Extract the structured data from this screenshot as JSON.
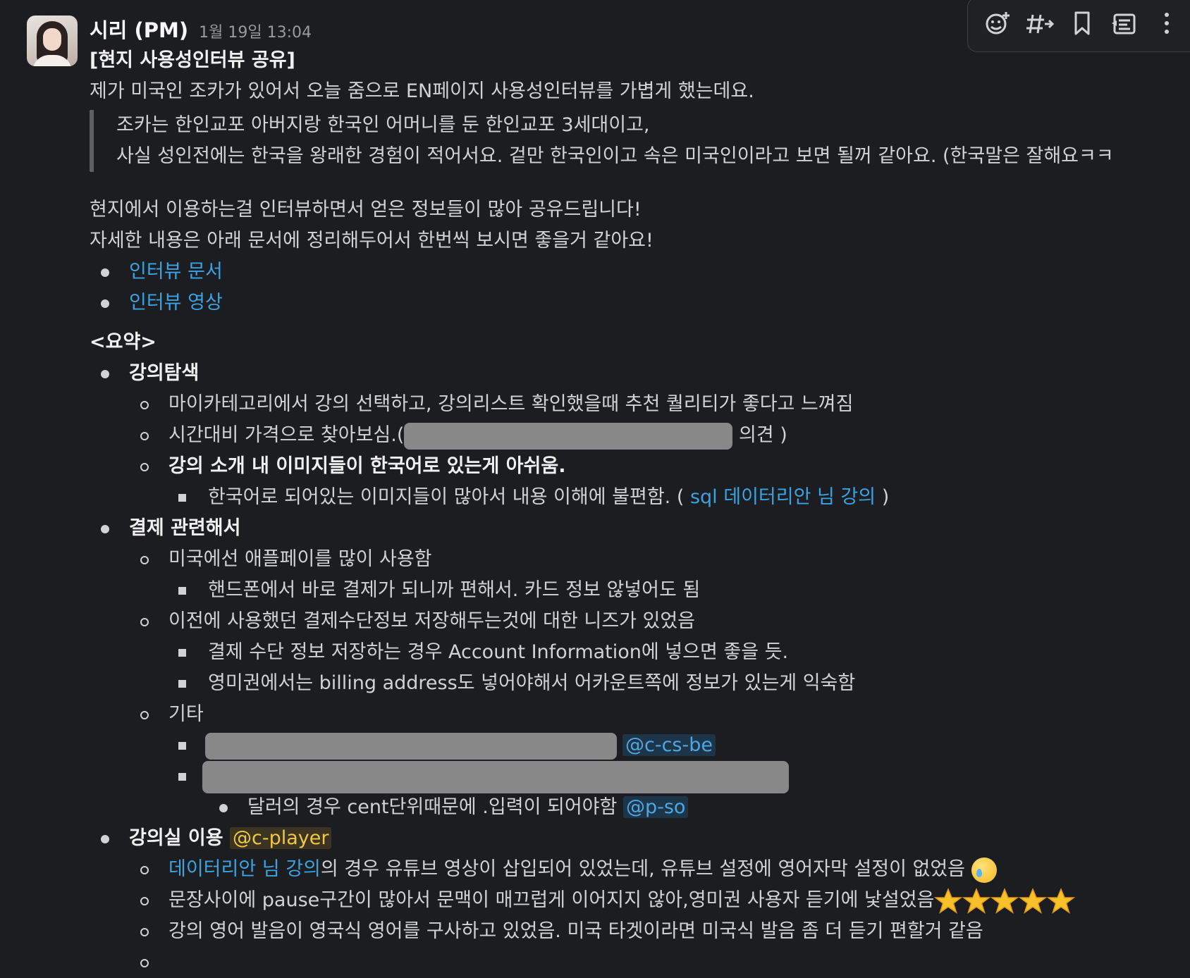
{
  "message": {
    "author": "시리 (PM)",
    "timestamp": "1월 19일 13:04",
    "title": "[현지 사용성인터뷰 공유]",
    "intro": "제가 미국인 조카가 있어서 오늘 줌으로 EN페이지 사용성인터뷰를 가볍게 했는데요.",
    "quote": [
      "조카는 한인교포 아버지랑 한국인 어머니를 둔 한인교포 3세대이고,",
      "사실 성인전에는 한국을 왕래한 경험이 적어서요. 겉만 한국인이고 속은 미국인이라고 보면 될꺼 같아요. (한국말은 잘해요ㅋㅋ"
    ],
    "para": [
      "현지에서 이용하는걸 인터뷰하면서 얻은 정보들이 많아 공유드립니다!",
      "자세한 내용은 아래 문서에 정리해두어서 한번씩 보시면 좋을거 같아요!"
    ],
    "links": [
      "인터뷰 문서",
      "인터뷰 영상"
    ],
    "summary_title": "<요약>",
    "s1": {
      "title": "강의탐색",
      "a": "마이카테고리에서 강의 선택하고, 강의리스트 확인했을때 추천 퀄리티가 좋다고 느껴짐",
      "b_pre": "시간대비 가격으로 찾아보심.(",
      "b_post": " 의견 )",
      "c": "강의 소개 내 이미지들이 한국어로 있는게 아쉬움.",
      "c1_pre": "한국어로 되어있는 이미지들이 많아서 내용 이해에 불편함. ( ",
      "c1_link": "sql 데이터리안 님 강의",
      "c1_post": " )"
    },
    "s2": {
      "title": "결제 관련해서",
      "a": "미국에선 애플페이를 많이 사용함",
      "a1": "핸드폰에서 바로 결제가 되니까 편해서. 카드 정보 않넣어도 됨",
      "b": "이전에 사용했던 결제수단정보 저장해두는것에 대한 니즈가 있었음",
      "b1": "결제 수단 정보 저장하는 경우 Account Information에 넣으면 좋을 듯.",
      "b2": "영미권에서는 billing address도 넣어야해서 어카운트쪽에 정보가 있는게 익숙함",
      "c": "기타",
      "c1_mention": "@c-cs-be",
      "c2a_text": "달러의 경우 cent단위때문에 .입력이 되어야함 ",
      "c2a_mention": "@p-so"
    },
    "s3": {
      "title": "강의실 이용 ",
      "mention": "@c-player",
      "a_link": "데이터리안 님 강의",
      "a_text": "의 경우 유튜브 영상이 삽입되어 있었는데, 유튜브 설정에 영어자막 설정이 없었음 ",
      "b": "문장사이에 pause구간이 많아서 문맥이 매끄럽게 이어지지 않아,영미권 사용자 듣기에 낯설었음",
      "c": "강의 영어 발음이 영국식 영어를 구사하고  있었음. 미국 타겟이라면 미국식 발음 좀 더 듣기 편할거 같음"
    }
  },
  "toolbar": [
    "add-reaction-icon",
    "share-channel-icon",
    "bookmark-icon",
    "forward-icon",
    "more-icon"
  ],
  "icons": {
    "emoji_cry": "crying-face-emoji",
    "star": "star-emoji"
  },
  "colors": {
    "background": "#1b1d21",
    "text": "#d1d2d3",
    "link": "#3aa3e3",
    "mention_self": "#f2c744"
  }
}
